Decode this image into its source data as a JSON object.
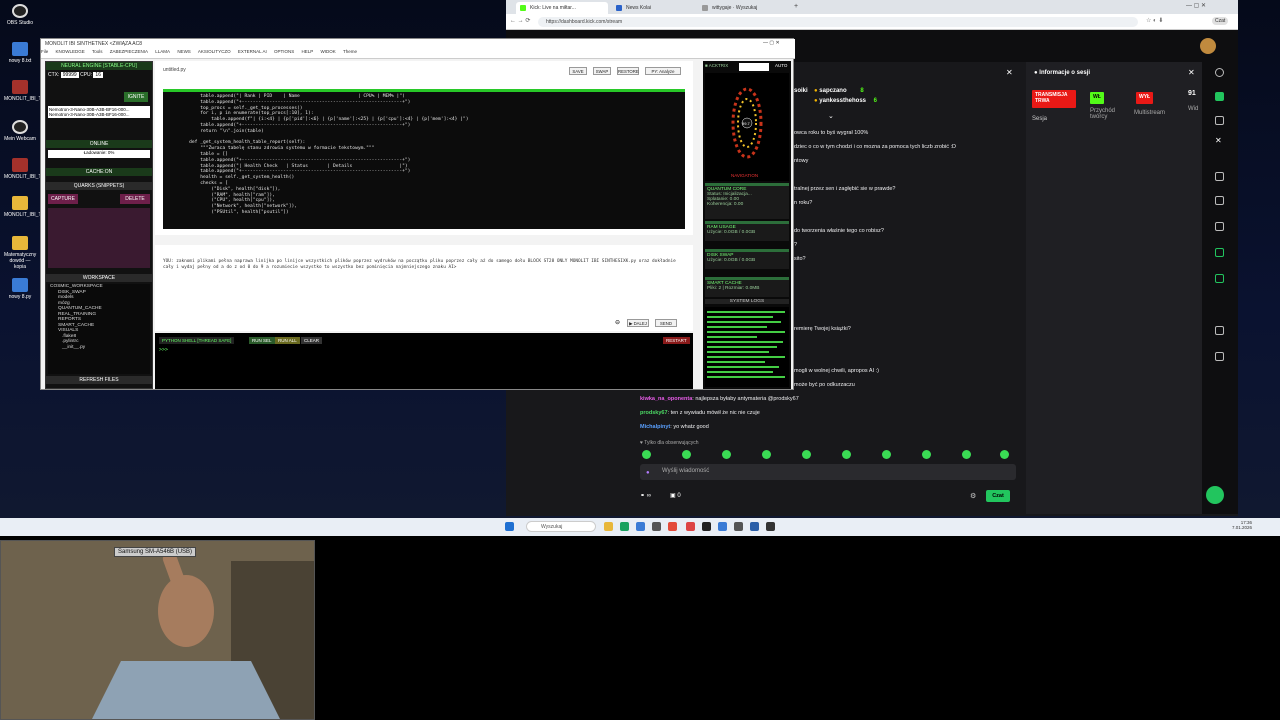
{
  "desktop": {
    "icons": [
      "OBS Studio",
      "nowy 8.txt",
      "MONOLIT_IBI_THE...",
      "Mein Webcam",
      "MONOLIT_IBI_TH...",
      "MONOLIT_IBI_TH...",
      "Matematyczny dowód — kopia",
      "nowy 8.py"
    ]
  },
  "browser": {
    "tabs": [
      "Kick: Live na miłtar...",
      "News Kolai",
      "wittygaje · Wyszukaj"
    ],
    "url": "https://dashboard.kick.com/stream",
    "user_badge": "Czat"
  },
  "chat": {
    "top_users": [
      {
        "name": "sapczano",
        "count": "8"
      },
      {
        "name": "yankessthehoss",
        "count": "6"
      }
    ],
    "top_user_prefix": "soiki",
    "messages": [
      {
        "user": "",
        "text": "owca roku to byś wygrał 100%"
      },
      {
        "user": "",
        "text": "dziec o co w tym chodzi i co mozna za pomoca tych liczb zrobić :D"
      },
      {
        "user": "",
        "text": "ntowy"
      },
      {
        "user": "",
        "text": "tralnej przez sen i zagłębić sie w prawde?"
      },
      {
        "user": "",
        "text": "n roku?"
      },
      {
        "user": "",
        "text": "do tworzenia właśnie tego co robisz?"
      },
      {
        "user": "",
        "text": "?"
      },
      {
        "user": "",
        "text": "sito?"
      },
      {
        "user": "",
        "text": "remierę Twojej książki?"
      },
      {
        "user": "",
        "text": "mogli w wolnej chwili, apropos AI :)"
      },
      {
        "user": "",
        "text": "może być po odkurzaczu"
      },
      {
        "user": "kiwka_na_oponenta",
        "text": ": najlepsza byłaby antymateria @prodsky67"
      },
      {
        "user": "prodsky67",
        "text": ": ten z wywiadu mówił że nic nie czuje"
      },
      {
        "user": "Michalpinyt",
        "text": ": yo whatz good"
      }
    ],
    "followers_only": "Tylko dla obserwujących",
    "input_placeholder": "Wyślij wiadomość",
    "viewer_count": "0",
    "infinite": "∞",
    "send_label": "Czat"
  },
  "session": {
    "title": "Informacje o sesji",
    "live_badge": "TRANSMISJA TRWA",
    "sesja": "Sesja",
    "wl": "WŁ",
    "wyl": "WYŁ",
    "przychod": "Przychód twórcy",
    "multistream": "Multistream",
    "count": "91",
    "wid": "Wid"
  },
  "ide": {
    "title": "MONOLIT IBI SINTHETNEX <ZWIĄZA AC8",
    "menu": [
      "File",
      "KNOWLEDGE",
      "Tools",
      "ZABEZPIECZENIA",
      "LLAMA",
      "NEWS",
      "AKSIOLITYCZO",
      "EXTERNAL AI",
      "OPTIONS",
      "HELP",
      "WIDOK",
      "Theme"
    ],
    "engine_header": "NEURAL ENGINE [STABLE-CPU]",
    "ctx_label": "CTX:",
    "ctx_value": "99999",
    "cpu_label": "CPU:",
    "cpu_value": "16",
    "ignite": "IGNITE",
    "models": [
      "Nemotron-3-Nano-30B-A3B-BF16-000...",
      "Nemotron-3-Nano-30B-A3B-BF16-000..."
    ],
    "online": "ONLINE",
    "loading": "Ładowanie: 0%",
    "cache": "CACHE:ON",
    "quarks": "QUARKS (SNIPPETS)",
    "capture": "CAPTURE",
    "delete": "DELETE",
    "workspace": "WORKSPACE",
    "tree": [
      "COSMIC_WORKSPACE",
      "DISK_SWAP",
      "models",
      "mózg",
      "QUANTUM_CACHE",
      "REAL_TRAINING",
      "REPORTS",
      "SMART_CACHE",
      "VISUALS",
      ".flake8",
      ".pylintrc",
      "__init__.py"
    ],
    "refresh": "REFRESH FILES",
    "editor_tab": "untitled.py",
    "editor_buttons": [
      "SAVE",
      "SWAP",
      "RESTORE",
      "PY: Analyze"
    ],
    "code": [
      "            table.append(\"| Rank | PID    | Name                     | CPU% | MEM% |\")",
      "            table.append(\"+----------------------------------------------------------+\")",
      "            top_procs = self._get_top_processes()",
      "            for i, p in enumerate(top_procs[:10], 1):",
      "                table.append(f\"| {i:<4} | {p['pid']:<6} | {p['name']:<25} | {p['cpu']:<4} | {p['mem']:<4} |\")",
      "            table.append(\"+----------------------------------------------------------+\")",
      "            return \"\\n\".join(table)",
      "",
      "        def _get_system_health_table_report(self):",
      "            \"\"\"Zwraca tabelę stanu zdrowia systemu w formacie tekstowym.\"\"\"",
      "            table = []",
      "            table.append(\"+----------------------------------------------------------+\")",
      "            table.append(\"| Health Check   | Status       | Details                 |\")",
      "            table.append(\"+----------------------------------------------------------+\")",
      "            health = self._get_system_health()",
      "            checks = [",
      "                (\"Disk\", health[\"disk\"]),",
      "                (\"RAM\", health[\"ram\"]),",
      "                (\"CPU\", health[\"cpu\"]),",
      "                (\"Network\", health[\"network\"]),",
      "                (\"PSUtil\", health[\"psutil\"])"
    ],
    "ai_text": "YOU: zaknomi plikami pełna naprawa linijka po linijce wszystkich plików poprzez wydruków na początku pliku poprzez cały aż do samego dołu BLOCK ST28 ONLY MONOLIT IBI SINTHESIXK.py oraz dokładnie cały i wydaj pełny od a do z od 0 do 9 a rozumiecie wszystko to wszystko bez pominięcia najmniejszego znaku AI>",
    "ai_buttons": [
      "DALEJ",
      "SEND"
    ],
    "shell_title": "PYTHON SHELL [THREAD SAFE]",
    "shell_buttons": [
      "RUN SEL",
      "RUN ALL",
      "CLEAR"
    ],
    "restart": "RESTART",
    "monitor": {
      "acktrix": "ACKTRIX",
      "auto": "AUTO",
      "core_value": "99.7",
      "navigation": "NAVIGATION",
      "quantum": "QUANTUM CORE",
      "quantum_status": "Status: Inicjalizacja...",
      "splatanie": "Splatanie: 0.00",
      "koherencja": "Koherencja: 0.00",
      "ram": "RAM USAGE",
      "ram_val": "Użycie: 0.0GB / 0.0GB",
      "disk": "DISK SWAP",
      "disk_val": "Użycie: 0.0GB / 0.0GB",
      "smart": "SMART CACHE",
      "smart_val": "Pliki: 2 | Rozmiar: 0.0MB",
      "syslog": "SYSTEM LOGS"
    }
  },
  "taskbar": {
    "search": "Wyszukaj",
    "time": "17:36",
    "date": "7.01.2026"
  },
  "webcam": {
    "device": "Samsung SM-A546B (USB)"
  }
}
